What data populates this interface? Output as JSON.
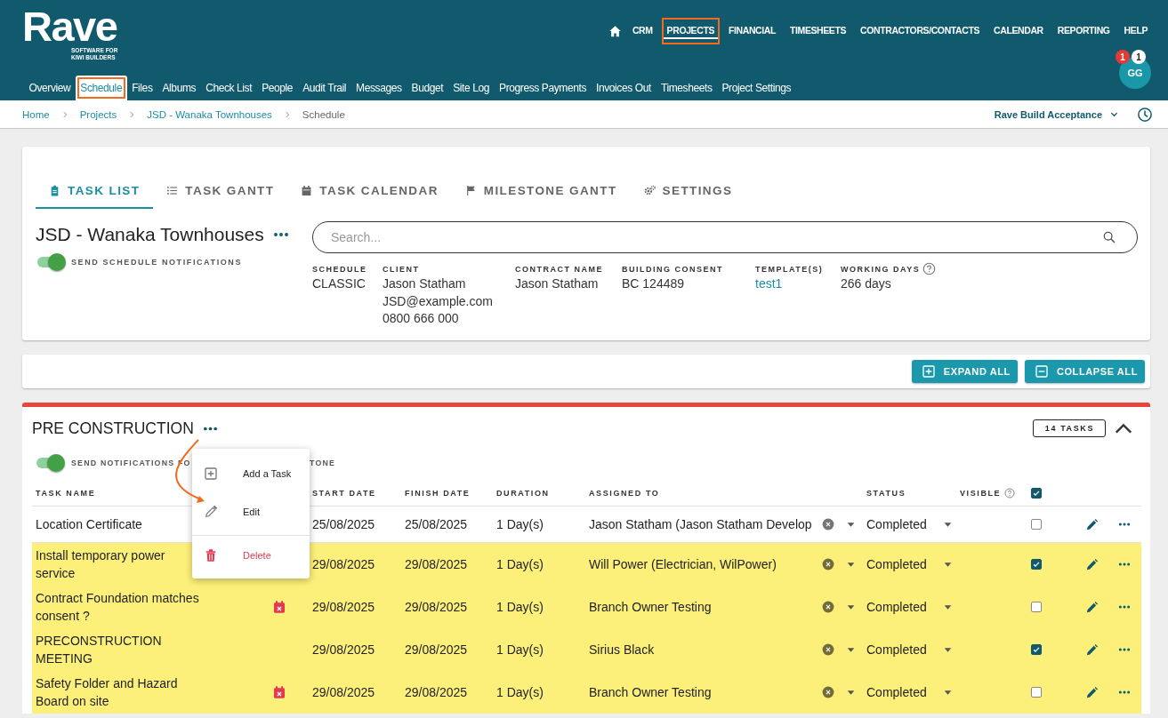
{
  "logo": {
    "name": "Rave",
    "tagline": "SOFTWARE FOR KIWI BUILDERS"
  },
  "top_nav": [
    {
      "label": "CRM",
      "selected": false,
      "highlighted": false
    },
    {
      "label": "PROJECTS",
      "selected": true,
      "highlighted": true
    },
    {
      "label": "FINANCIAL",
      "selected": false,
      "highlighted": false
    },
    {
      "label": "TIMESHEETS",
      "selected": false,
      "highlighted": false
    },
    {
      "label": "CONTRACTORS/CONTACTS",
      "selected": false,
      "highlighted": false
    },
    {
      "label": "CALENDAR",
      "selected": false,
      "highlighted": false
    },
    {
      "label": "REPORTING",
      "selected": false,
      "highlighted": false
    },
    {
      "label": "HELP",
      "selected": false,
      "highlighted": false
    }
  ],
  "sub_nav": [
    {
      "label": "Overview",
      "selected": false,
      "highlighted": false
    },
    {
      "label": "Schedule",
      "selected": true,
      "highlighted": true
    },
    {
      "label": "Files",
      "selected": false,
      "highlighted": false
    },
    {
      "label": "Albums",
      "selected": false,
      "highlighted": false
    },
    {
      "label": "Check List",
      "selected": false,
      "highlighted": false
    },
    {
      "label": "People",
      "selected": false,
      "highlighted": false
    },
    {
      "label": "Audit Trail",
      "selected": false,
      "highlighted": false
    },
    {
      "label": "Messages",
      "selected": false,
      "highlighted": false
    },
    {
      "label": "Budget",
      "selected": false,
      "highlighted": false
    },
    {
      "label": "Site Log",
      "selected": false,
      "highlighted": false
    },
    {
      "label": "Progress Payments",
      "selected": false,
      "highlighted": false
    },
    {
      "label": "Invoices Out",
      "selected": false,
      "highlighted": false
    },
    {
      "label": "Timesheets",
      "selected": false,
      "highlighted": false
    },
    {
      "label": "Project Settings",
      "selected": false,
      "highlighted": false
    }
  ],
  "avatar": {
    "initials": "GG",
    "badges": [
      {
        "count": "1",
        "color": "#e53935"
      },
      {
        "count": "1",
        "color": "#ffffff"
      }
    ]
  },
  "breadcrumb": [
    {
      "label": "Home",
      "kind": "link"
    },
    {
      "label": "Projects",
      "kind": "link"
    },
    {
      "label": "JSD - Wanaka Townhouses",
      "kind": "link"
    },
    {
      "label": "Schedule",
      "kind": "current"
    }
  ],
  "account_selector": "Rave Build Acceptance",
  "schedule_tabs": [
    {
      "label": "TASK LIST",
      "selected": true
    },
    {
      "label": "TASK GANTT",
      "selected": false
    },
    {
      "label": "TASK CALENDAR",
      "selected": false
    },
    {
      "label": "MILESTONE GANTT",
      "selected": false
    },
    {
      "label": "SETTINGS",
      "selected": false
    }
  ],
  "project": {
    "title": "JSD - Wanaka Townhouses",
    "notifications_toggle": {
      "label": "SEND SCHEDULE NOTIFICATIONS",
      "on": true
    },
    "search": {
      "placeholder": "Search..."
    },
    "details": [
      {
        "label": "SCHEDULE",
        "values": [
          "CLASSIC"
        ],
        "kind": "text",
        "help": false
      },
      {
        "label": "CLIENT",
        "values": [
          "Jason Statham",
          "JSD@example.com",
          "0800 666 000"
        ],
        "kind": "text",
        "help": false
      },
      {
        "label": "CONTRACT NAME",
        "values": [
          "Jason Statham"
        ],
        "kind": "text",
        "help": false
      },
      {
        "label": "BUILDING CONSENT",
        "values": [
          "BC 124489"
        ],
        "kind": "text",
        "help": false
      },
      {
        "label": "TEMPLATE(S)",
        "values": [
          "test1"
        ],
        "kind": "link",
        "help": false
      },
      {
        "label": "WORKING DAYS",
        "values": [
          "266 days"
        ],
        "kind": "text",
        "help": true
      }
    ]
  },
  "toolbar": {
    "buttons": [
      {
        "label": "EXPAND ALL",
        "kind": "expand"
      },
      {
        "label": "COLLAPSE ALL",
        "kind": "collapse"
      }
    ]
  },
  "section": {
    "title": "PRE CONSTRUCTION",
    "task_count": "14 TASKS",
    "expanded": true,
    "notifications_toggle": {
      "label_start": "SEND NOTIFICATIONS FO",
      "label_end": "TONE",
      "on": true
    },
    "columns": [
      "TASK NAME",
      "START DATE",
      "FINISH DATE",
      "DURATION",
      "ASSIGNED TO",
      "STATUS",
      "VISIBLE"
    ],
    "all_visible_checked": true,
    "rows": [
      {
        "task": "Location Certificate",
        "date_warning": false,
        "start": "25/08/2025",
        "finish": "25/08/2025",
        "duration": "1 Day(s)",
        "assigned_to": "Jason Statham (Jason Statham Develop",
        "status": "Completed",
        "visible": false,
        "highlighted": false
      },
      {
        "task": "Install temporary power service",
        "date_warning": false,
        "start": "29/08/2025",
        "finish": "29/08/2025",
        "duration": "1 Day(s)",
        "assigned_to": "Will Power (Electrician, WilPower)",
        "status": "Completed",
        "visible": true,
        "highlighted": true
      },
      {
        "task": "Contract Foundation matches consent ?",
        "date_warning": true,
        "start": "29/08/2025",
        "finish": "29/08/2025",
        "duration": "1 Day(s)",
        "assigned_to": "Branch Owner Testing",
        "status": "Completed",
        "visible": false,
        "highlighted": true
      },
      {
        "task": "PRECONSTRUCTION MEETING",
        "date_warning": false,
        "start": "29/08/2025",
        "finish": "29/08/2025",
        "duration": "1 Day(s)",
        "assigned_to": "Sirius Black",
        "status": "Completed",
        "visible": true,
        "highlighted": true
      },
      {
        "task": "Safety Folder and Hazard Board on site",
        "date_warning": true,
        "start": "29/08/2025",
        "finish": "29/08/2025",
        "duration": "1 Day(s)",
        "assigned_to": "Branch Owner Testing",
        "status": "Completed",
        "visible": false,
        "highlighted": true
      }
    ]
  },
  "context_menu": {
    "items": [
      {
        "label": "Add a Task",
        "kind": "add"
      },
      {
        "label": "Edit",
        "kind": "edit"
      },
      {
        "label": "Delete",
        "kind": "delete"
      }
    ]
  }
}
